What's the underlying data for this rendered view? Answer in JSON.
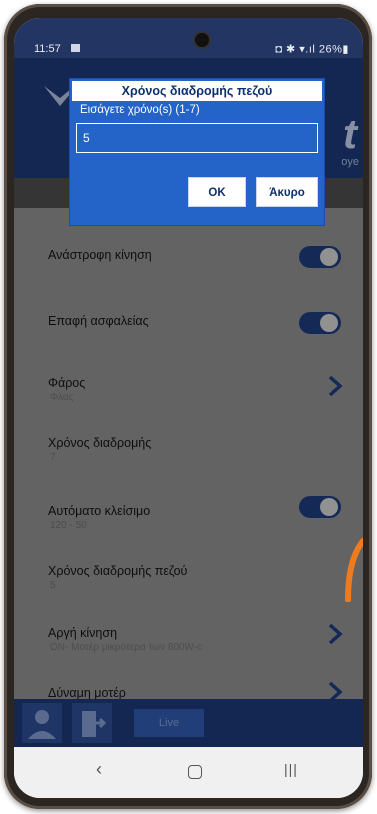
{
  "status_bar": {
    "time": "11:57",
    "right_text": "◘ ✱ ▾.ıl 26%▮"
  },
  "brand": {
    "letter": "t",
    "sub": "oye"
  },
  "dialog": {
    "title": "Χρόνος διαδρομής πεζού",
    "prompt": "Εισάγετε χρόνο(s) (1-7)",
    "input_value": "5",
    "ok_label": "OK",
    "cancel_label": "Άκυρο"
  },
  "settings": [
    {
      "label": "Ανάστροφη κίνηση",
      "sub": "",
      "control": "toggle"
    },
    {
      "label": "Επαφή ασφαλείας",
      "sub": "",
      "control": "toggle"
    },
    {
      "label": "Φάρος",
      "sub": "Φλας",
      "control": "chevron"
    },
    {
      "label": "Χρόνος διαδρομής",
      "sub": "7",
      "control": "none"
    },
    {
      "label": "Αυτόματο κλείσιμο",
      "sub": "120 - 50",
      "control": "toggle"
    },
    {
      "label": "Χρόνος διαδρομής πεζού",
      "sub": "5",
      "control": "none"
    },
    {
      "label": "Αργή κίνηση",
      "sub": "ON- Μοτέρ μικρότερα των 800W-c",
      "control": "chevron"
    },
    {
      "label": "Δύναμη μοτέρ",
      "sub": "",
      "control": "chevron"
    }
  ],
  "bottom_bar": {
    "live_label": "Live"
  },
  "colors": {
    "header": "#1c3672",
    "dialog": "#2463c7",
    "toggle": "#1e3a78",
    "accent_orange": "#f07a1e"
  }
}
